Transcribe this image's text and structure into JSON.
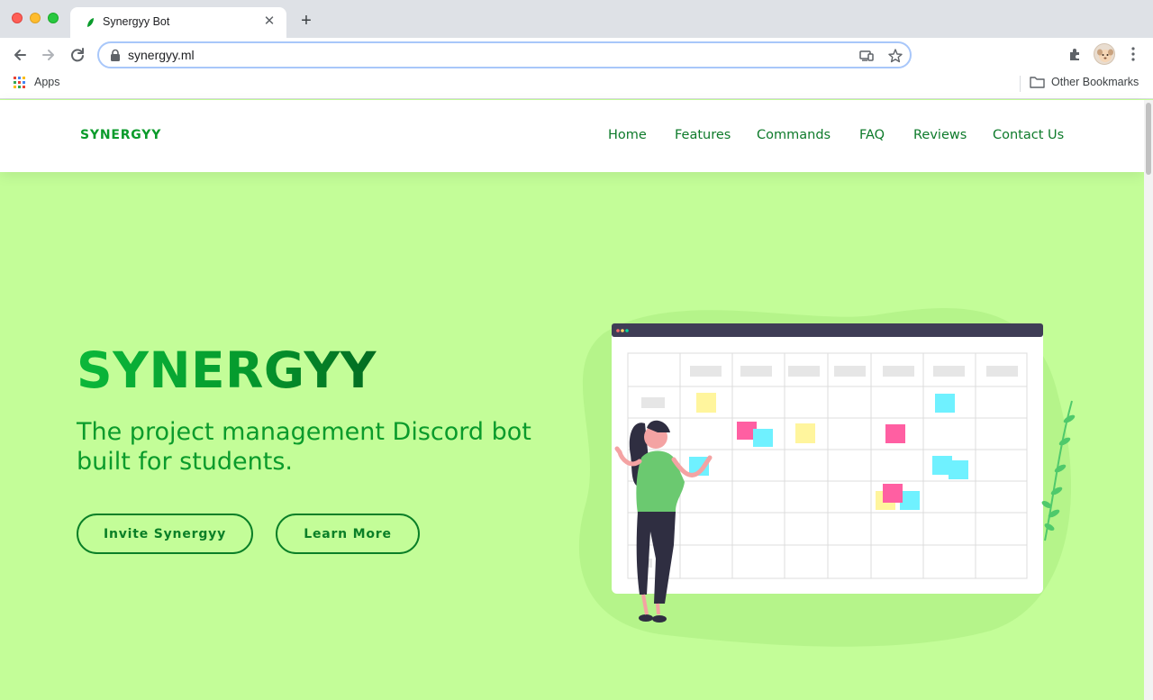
{
  "browser": {
    "tab_title": "Synergyy Bot",
    "url": "synergyy.ml",
    "bookmarks": {
      "apps_label": "Apps",
      "other_label": "Other Bookmarks"
    }
  },
  "site": {
    "logo": "SYNERGYY",
    "nav": [
      "Home",
      "Features",
      "Commands",
      "FAQ",
      "Reviews",
      "Contact Us"
    ],
    "hero": {
      "title": "SYNERGYY",
      "subtitle": "The project management Discord bot built for students.",
      "primary_button": "Invite Synergyy",
      "secondary_button": "Learn More"
    }
  },
  "colors": {
    "hero_background": "#c3fd98",
    "brand_green": "#0a9b2b",
    "nav_green": "#0d7a2a"
  },
  "icons": [
    "back-arrow-icon",
    "forward-arrow-icon",
    "reload-icon",
    "lock-icon",
    "cast-icon",
    "star-icon",
    "extensions-icon",
    "menu-dots-icon",
    "apps-grid-icon",
    "folder-icon"
  ]
}
